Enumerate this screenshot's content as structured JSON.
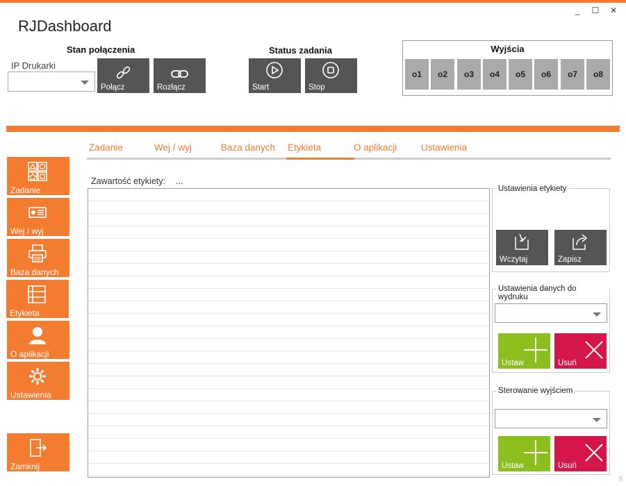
{
  "window": {
    "title": "RJDashboard",
    "controls": {
      "minimize": "_",
      "maximize": "☐",
      "close": "✕"
    },
    "accent": "#f47c30"
  },
  "connection": {
    "title": "Stan połączenia",
    "ip_label": "IP Drukarki",
    "ip_value": "",
    "connect_label": "Połącz",
    "disconnect_label": "Rozłącz"
  },
  "task_status": {
    "title": "Status zadania",
    "start_label": "Start",
    "stop_label": "Stop"
  },
  "outputs": {
    "title": "Wyjścia",
    "items": [
      "o1",
      "o2",
      "o3",
      "o4",
      "o5",
      "o6",
      "o7",
      "o8"
    ]
  },
  "sidebar": {
    "items": [
      {
        "label": "Zadanie",
        "icon": "shapes-icon"
      },
      {
        "label": "Wej / wyj",
        "icon": "io-card-icon"
      },
      {
        "label": "Baza danych",
        "icon": "printer-icon"
      },
      {
        "label": "Etykieta",
        "icon": "list-icon"
      },
      {
        "label": "O aplikacji",
        "icon": "user-icon"
      },
      {
        "label": "Ustawienia",
        "icon": "gear-icon"
      }
    ],
    "close_label": "Zamknij"
  },
  "tabs": {
    "items": [
      "Zadanie",
      "Wej / wyj",
      "Baza danych",
      "Etykieta",
      "O aplikacji",
      "Ustawienia"
    ],
    "active": "Etykieta"
  },
  "label_content": {
    "label": "Zawartość etykiety:",
    "value": "..."
  },
  "label_settings": {
    "title": "Ustawienia etykiety",
    "load_label": "Wczytaj",
    "save_label": "Zapisz"
  },
  "print_data_settings": {
    "title": "Ustawienia danych do wydruku",
    "select_value": "",
    "add_label": "Ustaw",
    "remove_label": "Usuń"
  },
  "output_control": {
    "title": "Sterowanie wyjściem",
    "select_value": "",
    "add_label": "Ustaw",
    "remove_label": "Usuń"
  }
}
